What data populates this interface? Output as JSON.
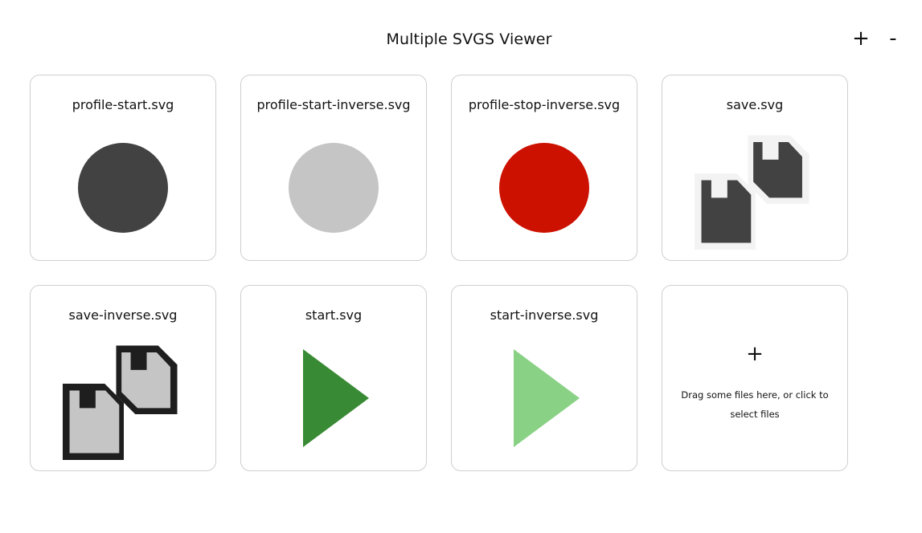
{
  "header": {
    "title": "Multiple SVGS Viewer",
    "zoom_in_label": "+",
    "zoom_out_label": "-"
  },
  "cards": [
    {
      "filename": "profile-start.svg",
      "icon": "circle-icon",
      "color": "#424242"
    },
    {
      "filename": "profile-start-inverse.svg",
      "icon": "circle-icon",
      "color": "#c5c5c5"
    },
    {
      "filename": "profile-stop-inverse.svg",
      "icon": "circle-icon",
      "color": "#cc1100"
    },
    {
      "filename": "save.svg",
      "icon": "floppy-disks-icon",
      "color": "#424242"
    },
    {
      "filename": "save-inverse.svg",
      "icon": "floppy-disks-icon",
      "color": "#c5c5c5"
    },
    {
      "filename": "start.svg",
      "icon": "play-icon",
      "color": "#388a34"
    },
    {
      "filename": "start-inverse.svg",
      "icon": "play-icon",
      "color": "#89d185"
    }
  ],
  "dropzone": {
    "plus": "+",
    "text": "Drag some files here, or click to select files"
  }
}
